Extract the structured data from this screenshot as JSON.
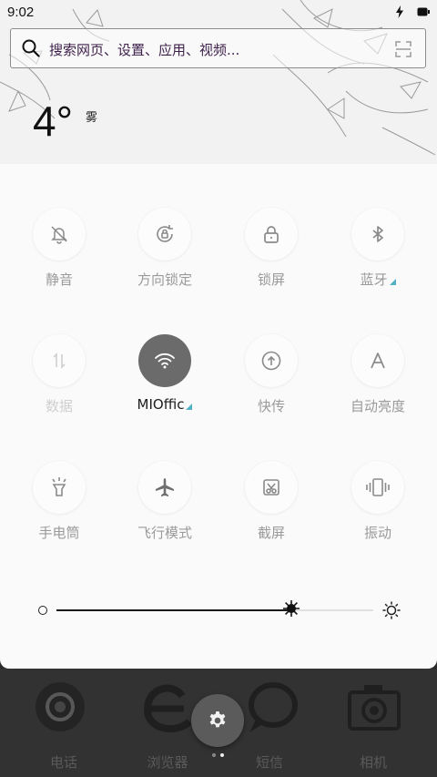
{
  "status_bar": {
    "time": "9:02"
  },
  "search": {
    "placeholder": "搜索网页、设置、应用、视频..."
  },
  "weather": {
    "temperature": "4°",
    "condition": "雾"
  },
  "tiles": [
    {
      "label": "静音",
      "icon": "bell-off-icon",
      "state": "off"
    },
    {
      "label": "方向锁定",
      "icon": "rotation-lock-icon",
      "state": "off"
    },
    {
      "label": "锁屏",
      "icon": "lock-icon",
      "state": "off"
    },
    {
      "label": "蓝牙",
      "icon": "bluetooth-icon",
      "state": "off",
      "expandable": true
    },
    {
      "label": "数据",
      "icon": "mobile-data-icon",
      "state": "disabled"
    },
    {
      "label": "MIOffic",
      "icon": "wifi-icon",
      "state": "on",
      "expandable": true
    },
    {
      "label": "快传",
      "icon": "quick-transfer-icon",
      "state": "off"
    },
    {
      "label": "自动亮度",
      "icon": "auto-brightness-icon",
      "state": "off"
    },
    {
      "label": "手电筒",
      "icon": "flashlight-icon",
      "state": "off"
    },
    {
      "label": "飞行模式",
      "icon": "airplane-icon",
      "state": "off"
    },
    {
      "label": "截屏",
      "icon": "screenshot-icon",
      "state": "off"
    },
    {
      "label": "振动",
      "icon": "vibrate-icon",
      "state": "off"
    }
  ],
  "brightness": {
    "level": 0.74
  },
  "dock": {
    "apps": [
      {
        "label": "电话",
        "icon": "phone-app-icon"
      },
      {
        "label": "浏览器",
        "icon": "browser-app-icon"
      },
      {
        "label": "短信",
        "icon": "messages-app-icon"
      },
      {
        "label": "相机",
        "icon": "camera-app-icon"
      }
    ],
    "page_count": 2,
    "current_page": 2
  },
  "colors": {
    "accent": "#4fb0c6",
    "active_tile": "#6b6b6b",
    "panel": "#fafafa"
  }
}
